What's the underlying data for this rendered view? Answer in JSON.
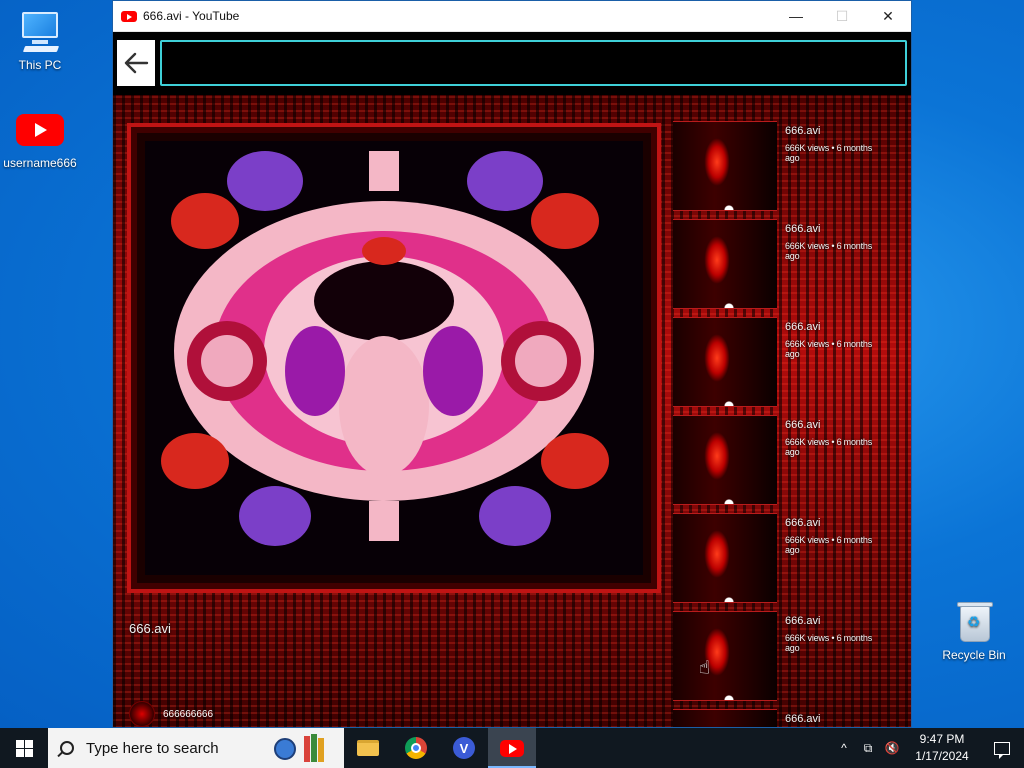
{
  "desktop": {
    "icons": [
      {
        "label": "This PC",
        "icon": "monitor-icon"
      },
      {
        "label": "username666",
        "icon": "youtube-icon"
      },
      {
        "label": "Recycle Bin",
        "icon": "recycle-bin-icon"
      }
    ]
  },
  "window": {
    "title": "666.avi - YouTube",
    "controls": {
      "minimize": "—",
      "maximize": "☐",
      "close": "✕"
    },
    "back_icon": "arrow-left-icon",
    "url_value": ""
  },
  "player": {
    "caption": "666.avi",
    "channel_name": "666666666"
  },
  "recommendations": [
    {
      "title": "666.avi",
      "meta": "666K views • 6 months ago"
    },
    {
      "title": "666.avi",
      "meta": "666K views • 6 months ago"
    },
    {
      "title": "666.avi",
      "meta": "666K views • 6 months ago"
    },
    {
      "title": "666.avi",
      "meta": "666K views • 6 months ago"
    },
    {
      "title": "666.avi",
      "meta": "666K views • 6 months ago"
    },
    {
      "title": "666.avi",
      "meta": "666K views • 6 months ago"
    },
    {
      "title": "666.avi",
      "meta": ""
    }
  ],
  "taskbar": {
    "search_placeholder": "Type here to search",
    "apps": [
      "file-explorer-icon",
      "chrome-icon",
      "v-app-icon",
      "youtube-icon"
    ],
    "time": "9:47 PM",
    "date": "1/17/2024",
    "tray": {
      "chevron": "^",
      "network": "⧉",
      "volume": "🔇"
    }
  },
  "colors": {
    "desktop_bg": "#0b74d6",
    "accent_cyan": "#3fd0d8",
    "youtube_red": "#ff0000",
    "taskbar_bg": "#101820"
  }
}
